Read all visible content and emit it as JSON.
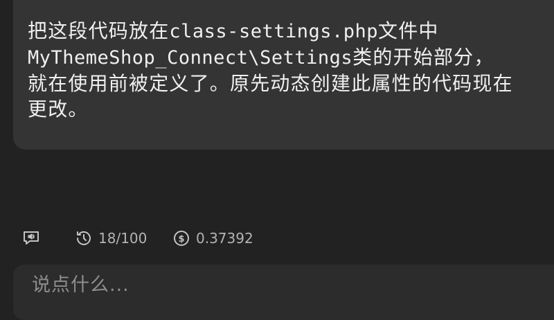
{
  "message": {
    "line1_prefix": "把这段代码放在",
    "line1_code": "class-settings.php",
    "line1_suffix": "文件中",
    "line2_code": "MyThemeShop_Connect\\Settings",
    "line2_suffix": "类的开始部分，",
    "line3": "就在使用前被定义了。原先动态创建此属性的代码现在",
    "line4": "更改。"
  },
  "stats": {
    "rounds": "18/100",
    "cost": "0.37392"
  },
  "icons": {
    "speech": "speech-bubble-icon",
    "history": "history-icon",
    "cost": "dollar-icon"
  },
  "input": {
    "placeholder": "说点什么..."
  },
  "colors": {
    "background": "#222222",
    "bubble": "#343434",
    "input": "#2c2c2c",
    "muted": "#b4b4b4"
  }
}
